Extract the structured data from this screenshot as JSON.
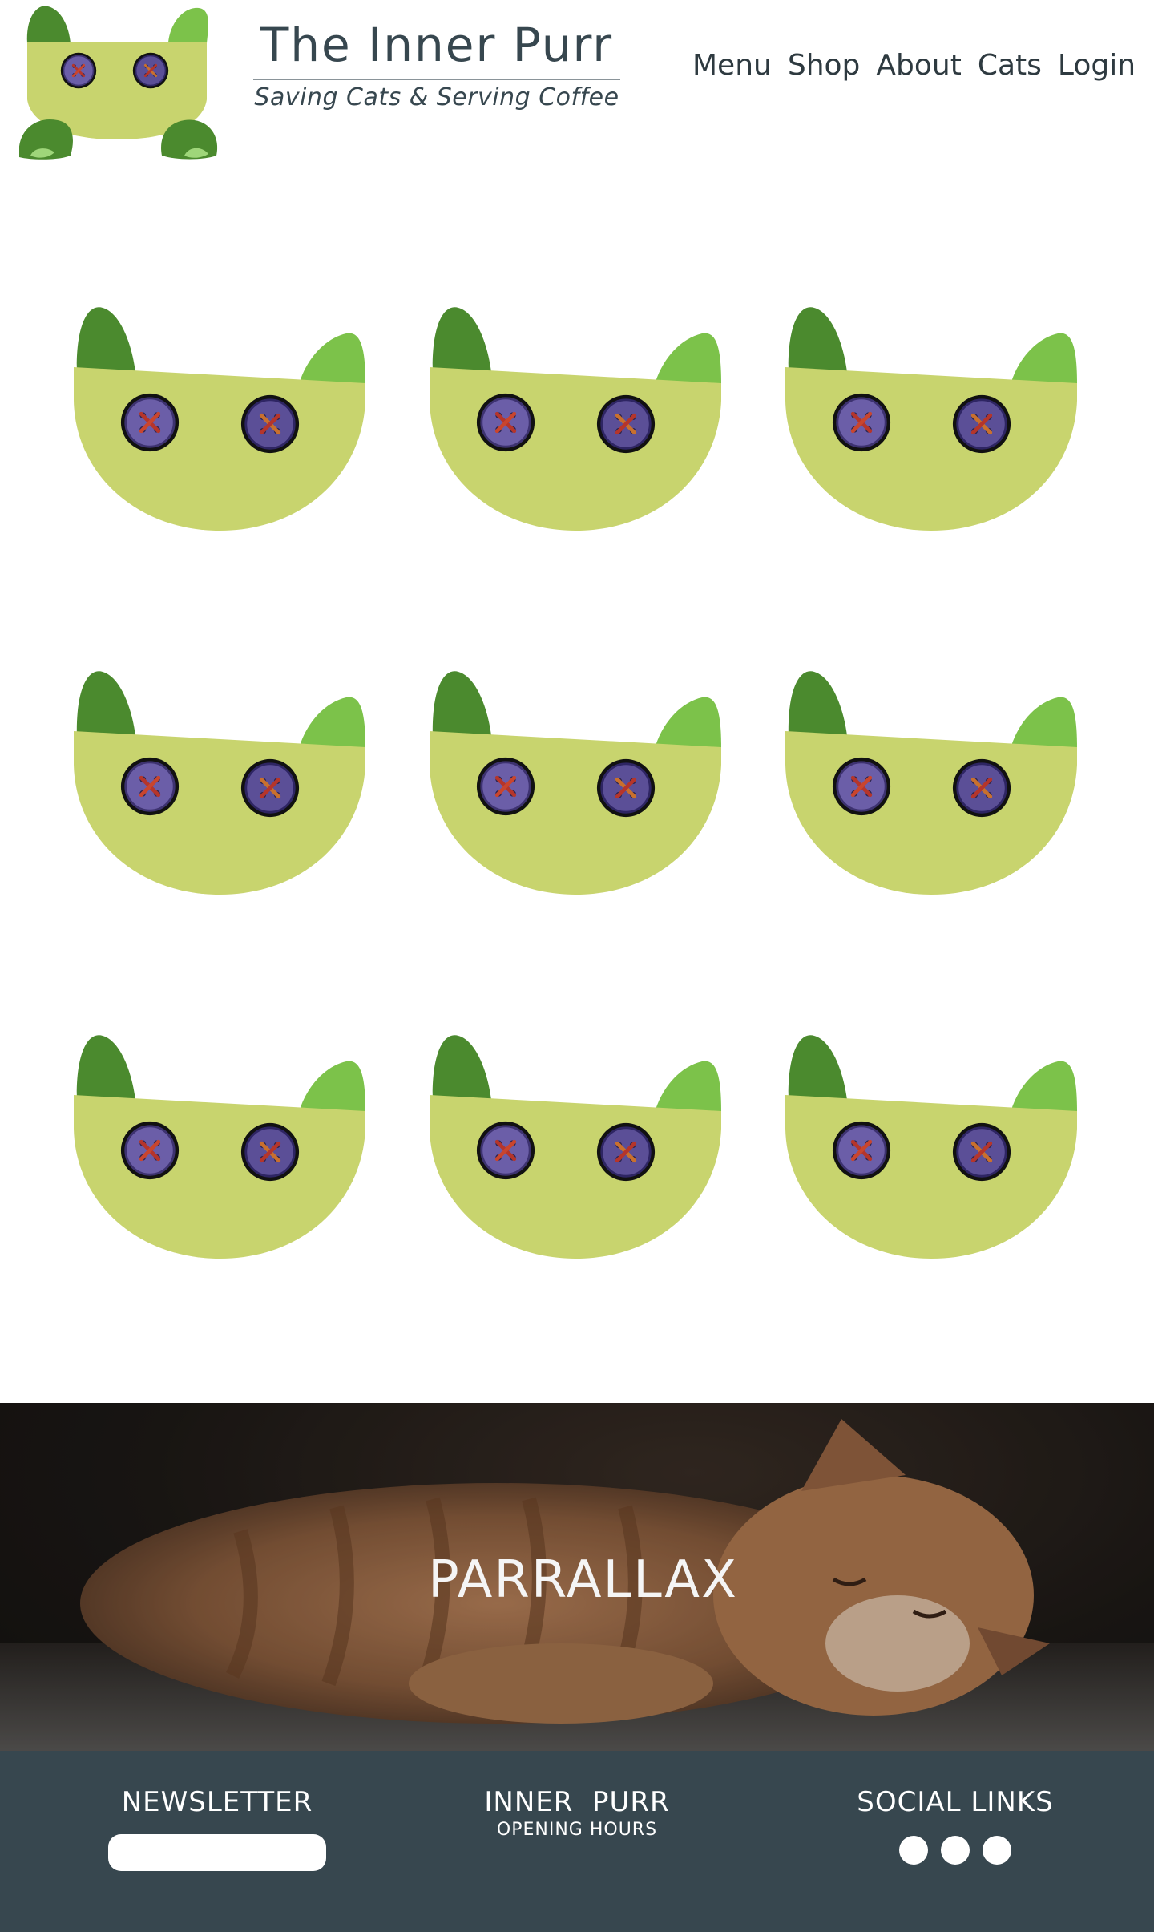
{
  "header": {
    "title": "The Inner Purr",
    "tagline": "Saving Cats & Serving Coffee",
    "logo_icon": "cat-head-logo-icon"
  },
  "nav": {
    "items": [
      {
        "label": "Menu"
      },
      {
        "label": "Shop"
      },
      {
        "label": "About"
      },
      {
        "label": "Cats"
      },
      {
        "label": "Login"
      }
    ]
  },
  "grid": {
    "icon": "cat-head-icon",
    "count": 9
  },
  "parallax": {
    "title": "PARRALLAX"
  },
  "footer": {
    "newsletter": {
      "heading": "NEWSLETTER",
      "input_value": ""
    },
    "hours": {
      "heading": "INNER  PURR",
      "subheading": "OPENING HOURS"
    },
    "social": {
      "heading": "SOCIAL LINKS",
      "links": 3
    }
  },
  "colors": {
    "face": "#c8d46e",
    "ear_dark": "#4b8a2e",
    "ear_light": "#7cc24a",
    "button": "#6b5ea8",
    "footer_bg": "#37474f",
    "text": "#37474f"
  }
}
